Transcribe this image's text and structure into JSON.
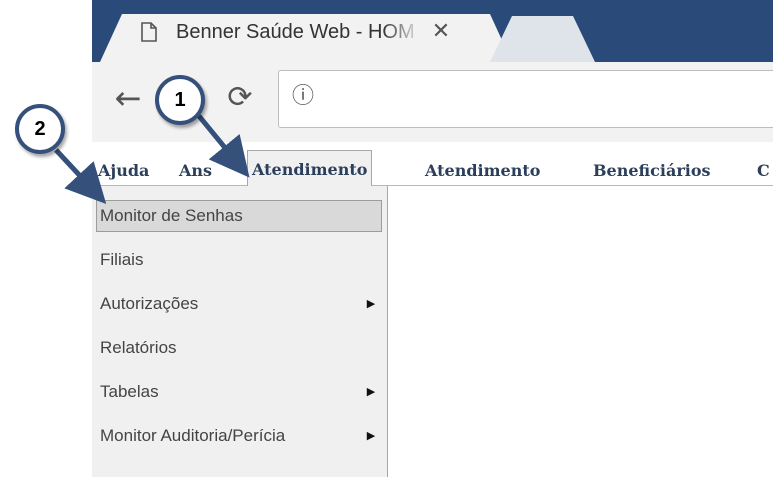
{
  "browser": {
    "tab_title": "Benner Saúde Web - HOM",
    "tab_icon": "document-icon",
    "close_glyph": "✕",
    "back_glyph": "←",
    "reload_glyph": "⟳",
    "info_glyph": "ⓘ"
  },
  "menubar": {
    "items": [
      {
        "label": "Ajuda"
      },
      {
        "label": "Ans"
      },
      {
        "label": "Atendimento",
        "active": true
      },
      {
        "label": "Atendimento"
      },
      {
        "label": "Beneficiários"
      },
      {
        "label": "C"
      }
    ]
  },
  "dropdown": {
    "items": [
      {
        "label": "Monitor de Senhas",
        "highlighted": true,
        "submenu": false
      },
      {
        "label": "Filiais",
        "submenu": false
      },
      {
        "label": "Autorizações",
        "submenu": true
      },
      {
        "label": "Relatórios",
        "submenu": false
      },
      {
        "label": "Tabelas",
        "submenu": true
      },
      {
        "label": "Monitor Auditoria/Perícia",
        "submenu": true
      }
    ],
    "submenu_glyph": "▶"
  },
  "callouts": [
    {
      "number": "1"
    },
    {
      "number": "2"
    }
  ],
  "colors": {
    "tabbar": "#2a4a7a",
    "callout_border": "#35507a",
    "menu_text": "#2b3f5a"
  }
}
